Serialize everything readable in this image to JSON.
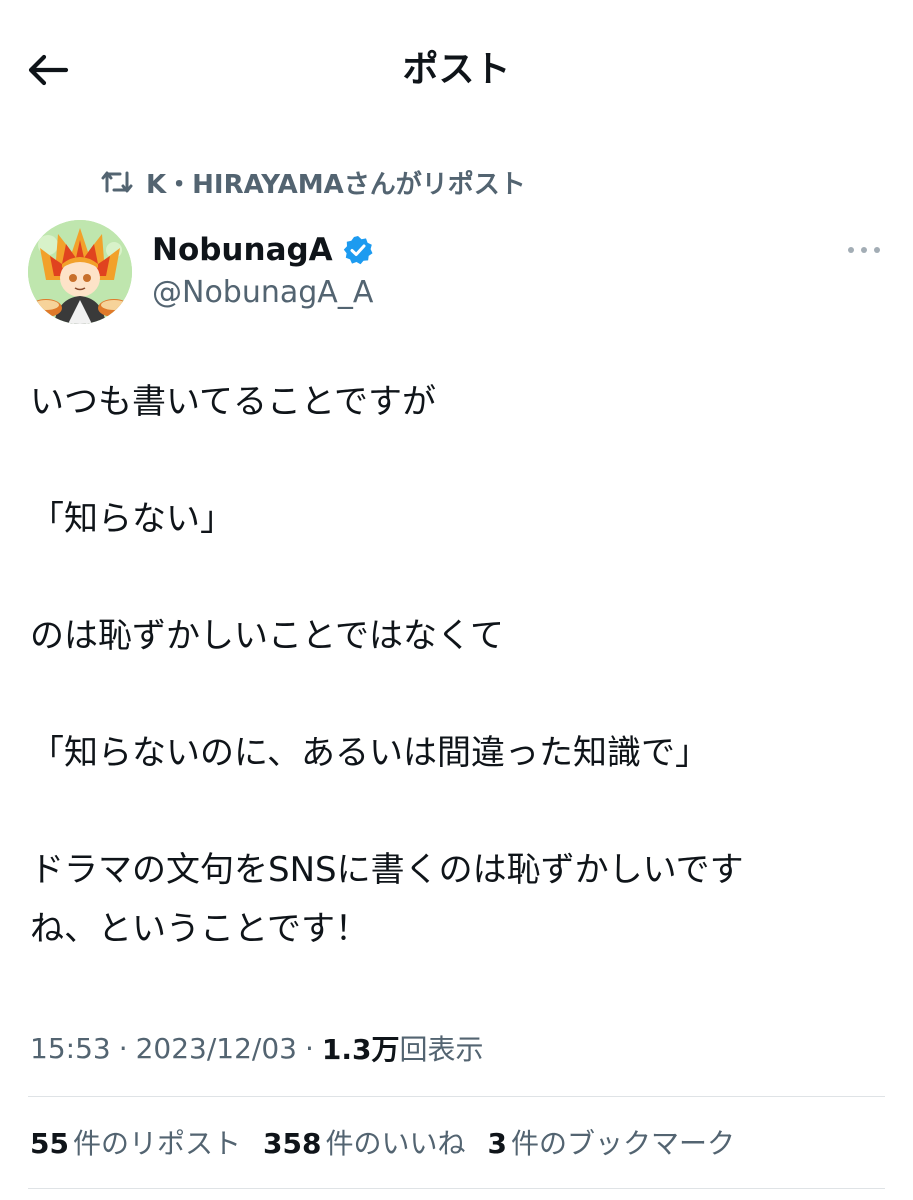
{
  "header": {
    "title": "ポスト"
  },
  "repost": {
    "text": "K・HIRAYAMAさんがリポスト"
  },
  "author": {
    "name": "NobunagA",
    "handle": "@NobunagA_A"
  },
  "tweet": {
    "lines": [
      "いつも書いてることですが",
      "「知らない」",
      "のは恥ずかしいことではなくて",
      "「知らないのに、あるいは間違った知識で」",
      "ドラマの文句をSNSに書くのは恥ずかしいです",
      "ね、ということです！"
    ]
  },
  "meta": {
    "time": "15:53",
    "date": "2023/12/03",
    "views_count": "1.3万",
    "views_label": "回表示"
  },
  "stats": {
    "reposts_count": "55",
    "reposts_label": "件のリポスト",
    "likes_count": "358",
    "likes_label": "件のいいね",
    "bookmarks_count": "3",
    "bookmarks_label": "件のブックマーク"
  },
  "colors": {
    "text": "#0f1419",
    "secondary": "#536471",
    "verified": "#1d9bf0",
    "divider": "#dfe3e6"
  },
  "icons": [
    "back-arrow-icon",
    "repost-icon",
    "verified-badge-icon",
    "more-icon"
  ]
}
